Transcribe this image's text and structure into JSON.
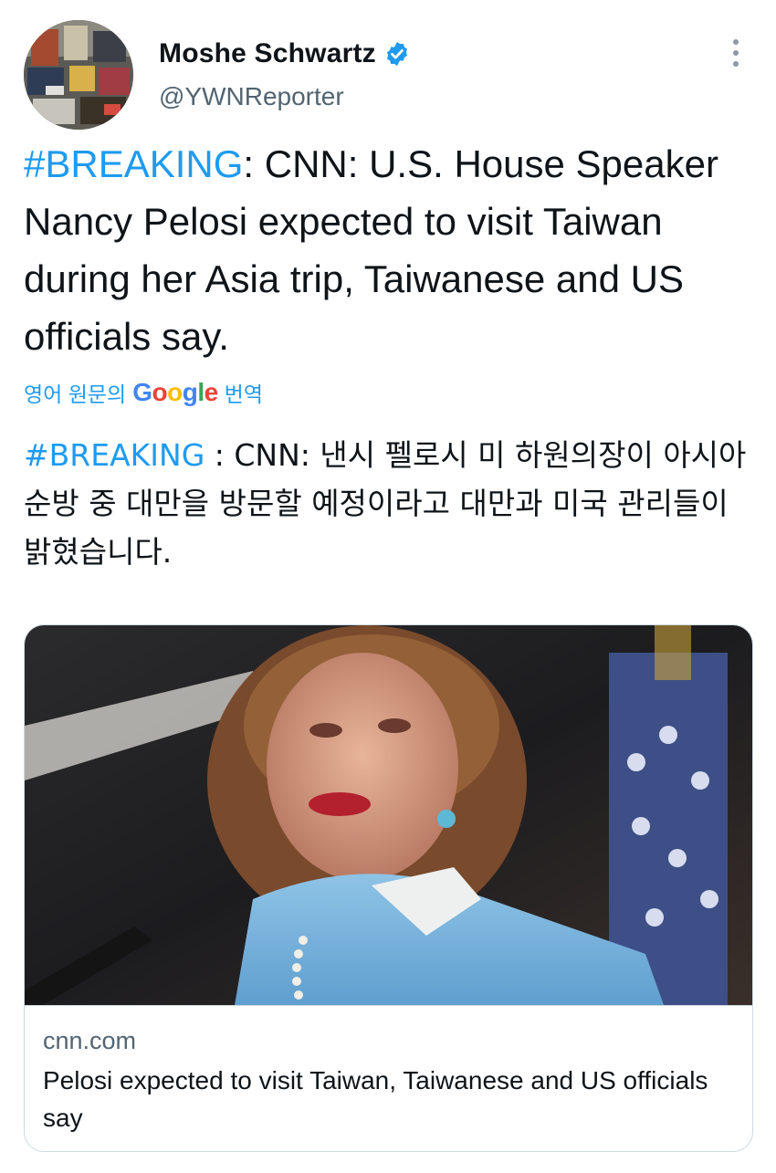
{
  "author": {
    "display_name": "Moshe Schwartz",
    "handle": "@YWNReporter",
    "verified": true,
    "avatar_icon": "avatar-photo",
    "verified_icon": "verified-badge-icon",
    "more_icon": "more-vertical-icon"
  },
  "tweet": {
    "hashtag": "#BREAKING",
    "text_after_hashtag": ": CNN: U.S. House Speaker Nancy Pelosi expected to visit Taiwan during her Asia trip, Taiwanese and US officials say."
  },
  "translation": {
    "label_prefix": "영어 원문의",
    "google_logo": "Google",
    "label_suffix": "번역",
    "hashtag": "#BREAKING",
    "text_after_hashtag": " : CNN: 낸시 펠로시 미 하원의장이 아시아 순방 중 대만을 방문할 예정이라고 대만과 미국 관리들이 밝혔습니다."
  },
  "card": {
    "domain": "cnn.com",
    "title": "Pelosi expected to visit Taiwan, Taiwanese and US officials say",
    "image_icon": "link-preview-photo"
  },
  "colors": {
    "link_blue": "#1d9bf0",
    "text_primary": "#0f1419",
    "text_secondary": "#536471",
    "border": "#cfd9de"
  }
}
